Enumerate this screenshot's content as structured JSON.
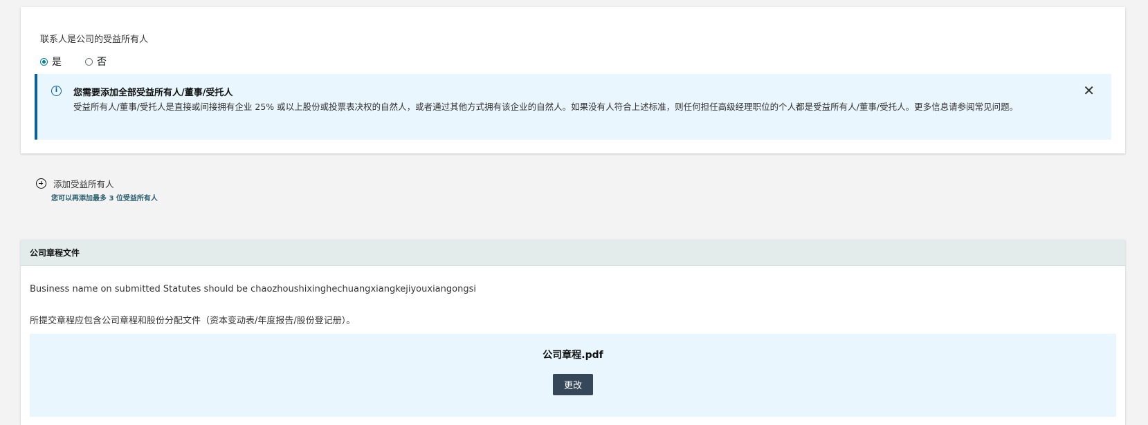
{
  "owner_section": {
    "question": "联系人是公司的受益所有人",
    "options": [
      {
        "label": "是",
        "checked": true
      },
      {
        "label": "否",
        "checked": false
      }
    ],
    "info": {
      "title": "您需要添加全部受益所有人/董事/受托人",
      "body": "受益所有人/董事/受托人是直接或间接拥有企业 25% 或以上股份或投票表决权的自然人，或者通过其他方式拥有该企业的自然人。如果没有人符合上述标准，则任何担任高级经理职位的个人都是受益所有人/董事/受托人。更多信息请参阅常见问题。",
      "close_glyph": "✕",
      "icon_glyph": "i"
    }
  },
  "add_owner": {
    "label": "添加受益所有人",
    "hint": "您可以再添加最多 3 位受益所有人"
  },
  "statutes": {
    "header": "公司章程文件",
    "business_name_note": "Business name on submitted Statutes should be chaozhoushixinghechuangxiangkejiyouxiangongsi",
    "requirement_note": "所提交章程应包含公司章程和股份分配文件（资本变动表/年度报告/股份登记册）。",
    "file_name": "公司章程.pdf",
    "change_label": "更改"
  },
  "colors": {
    "accent_teal": "#008296",
    "info_border": "#0b5fa0",
    "info_bg": "#eaf6fd",
    "button_dark": "#37475a"
  }
}
